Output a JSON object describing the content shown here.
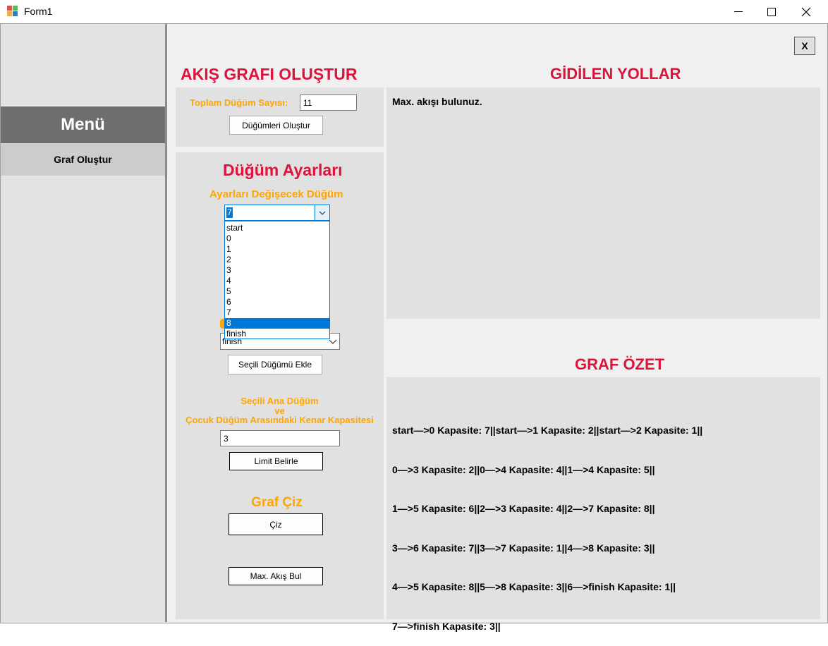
{
  "window": {
    "title": "Form1"
  },
  "sidebar": {
    "menu_title": "Menü",
    "items": [
      {
        "label": "Graf Oluştur"
      }
    ]
  },
  "main": {
    "close_label": "X",
    "create_section": {
      "title": "AKIŞ GRAFI OLUŞTUR",
      "node_count_label": "Toplam Düğüm Sayısı:",
      "node_count_value": "11",
      "create_nodes_button": "Düğümleri Oluştur"
    },
    "node_settings": {
      "title": "Düğüm Ayarları",
      "changing_node_label": "Ayarları Değişecek Düğüm",
      "selected_node": "7",
      "dropdown_options": [
        "start",
        "0",
        "1",
        "2",
        "3",
        "4",
        "5",
        "6",
        "7",
        "8",
        "finish"
      ],
      "highlighted_option": "8",
      "child_node_value": "finish",
      "add_node_button": "Seçili Düğümü Ekle",
      "capacity_label_lines": [
        "Seçili Ana Düğüm",
        "ve",
        "Çocuk Düğüm Arasındaki Kenar Kapasitesi"
      ],
      "capacity_value": "3",
      "set_limit_button": "Limit Belirle"
    },
    "draw_section": {
      "title": "Graf Çiz",
      "draw_button": "Çiz",
      "max_flow_button": "Max. Akış Bul"
    },
    "paths": {
      "title": "GİDİLEN YOLLAR",
      "text": "Max. akışı bulunuz."
    },
    "summary": {
      "title": "GRAF ÖZET",
      "lines": [
        "start—>0 Kapasite: 7||start—>1 Kapasite: 2||start—>2 Kapasite: 1||",
        "0—>3 Kapasite: 2||0—>4 Kapasite: 4||1—>4 Kapasite: 5||",
        "1—>5 Kapasite: 6||2—>3 Kapasite: 4||2—>7 Kapasite: 8||",
        "3—>6 Kapasite: 7||3—>7 Kapasite: 1||4—>8 Kapasite: 3||",
        "4—>5 Kapasite: 8||5—>8 Kapasite: 3||6—>finish Kapasite: 1||",
        "7—>finish Kapasite: 3||"
      ]
    }
  }
}
